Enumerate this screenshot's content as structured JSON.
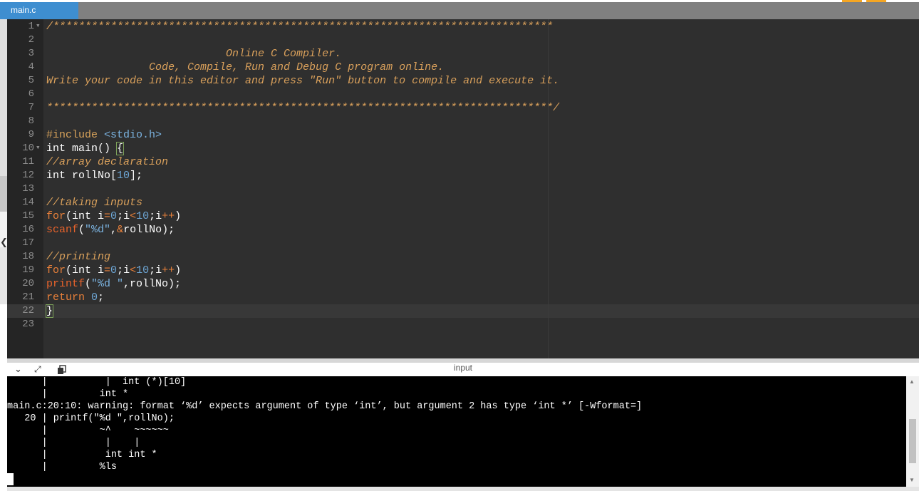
{
  "tab": {
    "label": "main.c"
  },
  "editor": {
    "lines": [
      {
        "n": "1",
        "fold": "▾",
        "tokens": [
          [
            "c-com",
            "/******************************************************************************"
          ]
        ]
      },
      {
        "n": "2",
        "fold": "",
        "tokens": []
      },
      {
        "n": "3",
        "fold": "",
        "tokens": [
          [
            "c-com",
            "                            Online C Compiler."
          ]
        ]
      },
      {
        "n": "4",
        "fold": "",
        "tokens": [
          [
            "c-com",
            "                Code, Compile, Run and Debug C program online."
          ]
        ]
      },
      {
        "n": "5",
        "fold": "",
        "tokens": [
          [
            "c-com",
            "Write your code in this editor and press \"Run\" button to compile and execute it."
          ]
        ]
      },
      {
        "n": "6",
        "fold": "",
        "tokens": []
      },
      {
        "n": "7",
        "fold": "",
        "tokens": [
          [
            "c-com",
            "*******************************************************************************/"
          ]
        ]
      },
      {
        "n": "8",
        "fold": "",
        "tokens": []
      },
      {
        "n": "9",
        "fold": "",
        "tokens": [
          [
            "c-inc",
            "#include "
          ],
          [
            "c-hdr",
            "<stdio.h>"
          ]
        ]
      },
      {
        "n": "10",
        "fold": "▾",
        "tokens": [
          [
            "c-plain",
            "int main() "
          ],
          [
            "bracket",
            "{"
          ]
        ]
      },
      {
        "n": "11",
        "fold": "",
        "tokens": [
          [
            "c-com",
            "//array declaration"
          ]
        ]
      },
      {
        "n": "12",
        "fold": "",
        "tokens": [
          [
            "c-plain",
            "int rollNo["
          ],
          [
            "c-num",
            "10"
          ],
          [
            "c-plain",
            "];"
          ]
        ]
      },
      {
        "n": "13",
        "fold": "",
        "tokens": []
      },
      {
        "n": "14",
        "fold": "",
        "tokens": [
          [
            "c-com",
            "//taking inputs"
          ]
        ]
      },
      {
        "n": "15",
        "fold": "",
        "tokens": [
          [
            "c-kw",
            "for"
          ],
          [
            "c-plain",
            "(int i"
          ],
          [
            "c-op",
            "="
          ],
          [
            "c-num",
            "0"
          ],
          [
            "c-plain",
            ";i"
          ],
          [
            "c-op",
            "<"
          ],
          [
            "c-num",
            "10"
          ],
          [
            "c-plain",
            ";i"
          ],
          [
            "c-op",
            "++"
          ],
          [
            "c-plain",
            ")"
          ]
        ]
      },
      {
        "n": "16",
        "fold": "",
        "tokens": [
          [
            "c-fn",
            "scanf"
          ],
          [
            "c-plain",
            "("
          ],
          [
            "c-str",
            "\"%d\""
          ],
          [
            "c-plain",
            ","
          ],
          [
            "c-op",
            "&"
          ],
          [
            "c-plain",
            "rollNo);"
          ]
        ]
      },
      {
        "n": "17",
        "fold": "",
        "tokens": []
      },
      {
        "n": "18",
        "fold": "",
        "tokens": [
          [
            "c-com",
            "//printing"
          ]
        ]
      },
      {
        "n": "19",
        "fold": "",
        "tokens": [
          [
            "c-kw",
            "for"
          ],
          [
            "c-plain",
            "(int i"
          ],
          [
            "c-op",
            "="
          ],
          [
            "c-num",
            "0"
          ],
          [
            "c-plain",
            ";i"
          ],
          [
            "c-op",
            "<"
          ],
          [
            "c-num",
            "10"
          ],
          [
            "c-plain",
            ";i"
          ],
          [
            "c-op",
            "++"
          ],
          [
            "c-plain",
            ")"
          ]
        ]
      },
      {
        "n": "20",
        "fold": "",
        "tokens": [
          [
            "c-fn",
            "printf"
          ],
          [
            "c-plain",
            "("
          ],
          [
            "c-str",
            "\"%d \""
          ],
          [
            "c-plain",
            ",rollNo);"
          ]
        ]
      },
      {
        "n": "21",
        "fold": "",
        "tokens": [
          [
            "c-kw",
            "return "
          ],
          [
            "c-num",
            "0"
          ],
          [
            "c-plain",
            ";"
          ]
        ]
      },
      {
        "n": "22",
        "fold": "",
        "tokens": [
          [
            "bracket",
            "}"
          ]
        ],
        "cursor": true
      },
      {
        "n": "23",
        "fold": "",
        "tokens": []
      }
    ]
  },
  "panel": {
    "title": "input",
    "collapse_icon": "chevron-down-icon",
    "expand_icon": "expand-icon",
    "copy_icon": "copy-icon"
  },
  "terminal": {
    "lines": [
      "      |          |  int (*)[10]",
      "      |         int *",
      "main.c:20:10: warning: format ‘%d’ expects argument of type ‘int’, but argument 2 has type ‘int *’ [-Wformat=]",
      "   20 | printf(\"%d \",rollNo);",
      "      |         ~^    ~~~~~~",
      "      |          |    |",
      "      |          int int *",
      "      |         %ls"
    ]
  },
  "colors": {
    "tab_active": "#3e8ed0",
    "editor_bg": "#2f2f2f",
    "comment": "#d9a05b",
    "keyword": "#e8803a"
  }
}
